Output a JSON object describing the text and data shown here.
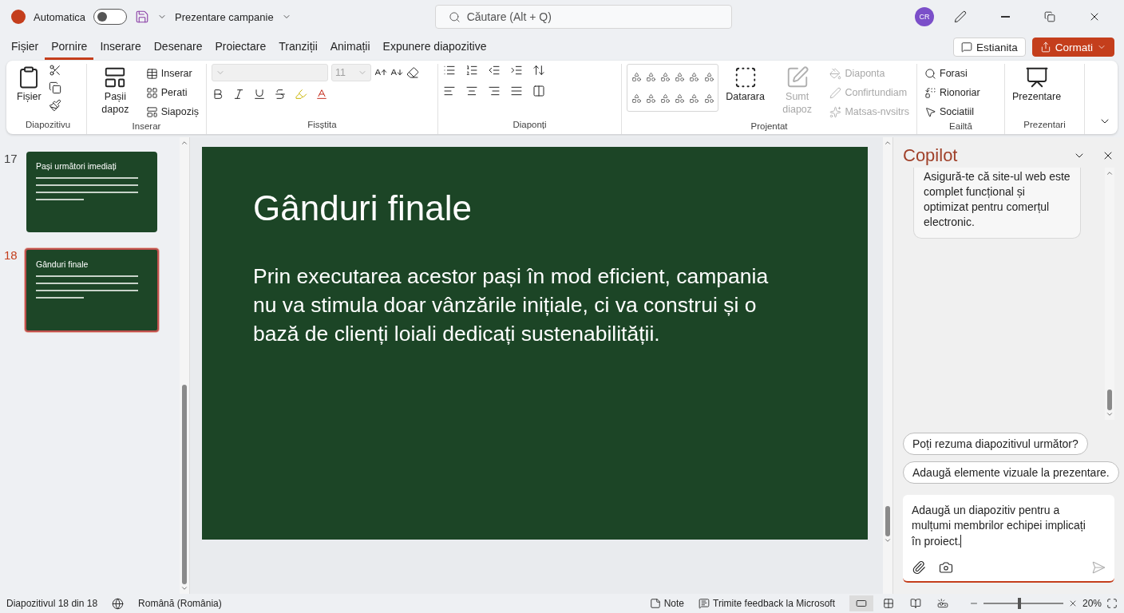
{
  "titlebar": {
    "autosave": {
      "label": "Automatica",
      "on": false
    },
    "document_title": "Prezentare campanie",
    "search": {
      "placeholder": "Căutare (Alt + Q)"
    },
    "avatar": "CR"
  },
  "tabs": [
    {
      "label": "Fișier",
      "selected": false
    },
    {
      "label": "Pornire",
      "selected": true
    },
    {
      "label": "Inserare",
      "selected": false
    },
    {
      "label": "Desenare",
      "selected": false
    },
    {
      "label": "Proiectare",
      "selected": false
    },
    {
      "label": "Tranziții",
      "selected": false
    },
    {
      "label": "Animații",
      "selected": false
    },
    {
      "label": "Expunere diapozitive",
      "selected": false
    }
  ],
  "actions": [
    {
      "kind": "comments",
      "label": "Estianita"
    },
    {
      "kind": "share",
      "label": "Cormati"
    }
  ],
  "ribbon": {
    "groups": [
      {
        "kind": "clipboard",
        "label": "Diapozitivu",
        "items": [
          {
            "label": "Fișier",
            "disabled": false
          }
        ]
      },
      {
        "kind": "slides",
        "label": "Inserar",
        "items": [
          {
            "label": "Pașii dapoz",
            "disabled": false
          },
          {
            "label": "Inserar",
            "disabled": false
          },
          {
            "label": "Perati",
            "disabled": false
          },
          {
            "label": "Siapoziș",
            "disabled": false
          }
        ]
      },
      {
        "kind": "font",
        "label": "Fisștita",
        "font_name": {
          "disabled": true
        },
        "font_size": {
          "value": "11",
          "disabled": true
        }
      },
      {
        "kind": "paragraph",
        "label": "Diaponți"
      },
      {
        "kind": "drawing",
        "label": "Projentat",
        "items": [
          {
            "label": "Datarara",
            "disabled": false
          },
          {
            "label": "Sumt diapoz",
            "disabled": true
          },
          {
            "label": "Diaponta",
            "disabled": true
          },
          {
            "label": "Confirtundiam",
            "disabled": true
          },
          {
            "label": "Matsas-nvsitrs",
            "disabled": true
          }
        ]
      },
      {
        "kind": "editing",
        "label": "Eailtă",
        "items": [
          {
            "label": "Forasi",
            "disabled": false
          },
          {
            "label": "Rionoriar",
            "disabled": false
          },
          {
            "label": "Sociatiil",
            "disabled": false
          }
        ]
      },
      {
        "kind": "addin",
        "label": "Prezentari",
        "items": [
          {
            "label": "Prezentare",
            "disabled": false
          }
        ]
      }
    ]
  },
  "thumbnails": [
    {
      "number": "17",
      "title": "Pași următori imediați",
      "selected": false
    },
    {
      "number": "18",
      "title": "Gânduri finale",
      "selected": true
    }
  ],
  "slide": {
    "title": "Gânduri finale",
    "body": "Prin executarea acestor pași în mod eficient, campania nu va stimula doar vânzările inițiale, ci va construi și o bază de clienți loiali dedicați sustenabilității."
  },
  "copilot": {
    "title": "Copilot",
    "message": "Asigură-te că site-ul web este complet funcțional și optimizat pentru comerțul electronic.",
    "suggestions": [
      "Poți rezuma diapozitivul următor?",
      "Adaugă elemente vizuale la prezentare."
    ],
    "input": "Adaugă un diapozitiv pentru a mulțumi membrilor echipei implicați în proiect."
  },
  "status_bar": {
    "slide_count": "Diapozitivul 18 din 18",
    "language": "Română (România)",
    "notes": "Note",
    "feedback": "Trimite feedback la Microsoft",
    "views": [
      {
        "selected": true
      },
      {
        "selected": false
      },
      {
        "selected": false
      },
      {
        "selected": false
      }
    ],
    "zoom": {
      "level": 0.45,
      "reading": "20%"
    }
  }
}
